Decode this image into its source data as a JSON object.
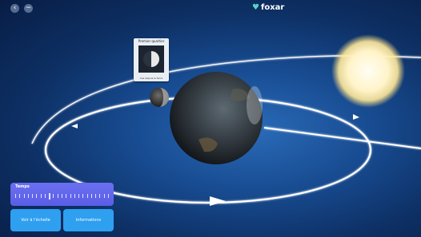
{
  "app": {
    "logo_text": "foxar"
  },
  "controls": {
    "back_glyph": "‹",
    "minus_glyph": "−"
  },
  "phase_card": {
    "title": "Premier quartier",
    "caption": "Vue depuis la Terre"
  },
  "time_panel": {
    "label": "Temps",
    "tick_count": 23,
    "major_tick_index": 8
  },
  "buttons": {
    "scale_label": "Voir à l'échelle",
    "info_label": "Informations"
  },
  "colors": {
    "panel": "#6b6ff0",
    "button": "#2f9ff0",
    "orbit": "#ffffff",
    "sun": "#fff6da",
    "logo_mark": "#5ad2c8"
  }
}
